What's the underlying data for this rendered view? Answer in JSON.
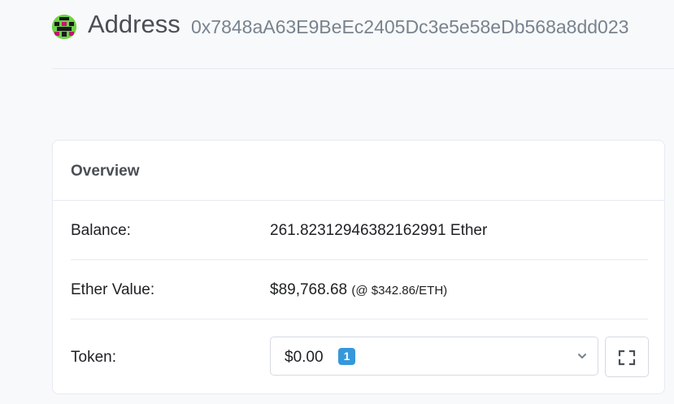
{
  "header": {
    "avatar_icon": "pixel-identicon",
    "title": "Address",
    "address": "0x7848aA63E9BeEc2405Dc3e5e58eDb568a8dd023"
  },
  "overview": {
    "title": "Overview",
    "balance": {
      "label": "Balance:",
      "value": "261.82312946382162991 Ether"
    },
    "ether_value": {
      "label": "Ether Value:",
      "value": "$89,768.68",
      "rate": "(@ $342.86/ETH)"
    },
    "token": {
      "label": "Token:",
      "amount": "$0.00",
      "count": "1",
      "dropdown_icon": "chevron-down-icon",
      "expand_icon": "expand-icon"
    }
  },
  "colors": {
    "background": "#f8f9fa",
    "badge": "#3498db",
    "avatar": "#6fd04a"
  }
}
